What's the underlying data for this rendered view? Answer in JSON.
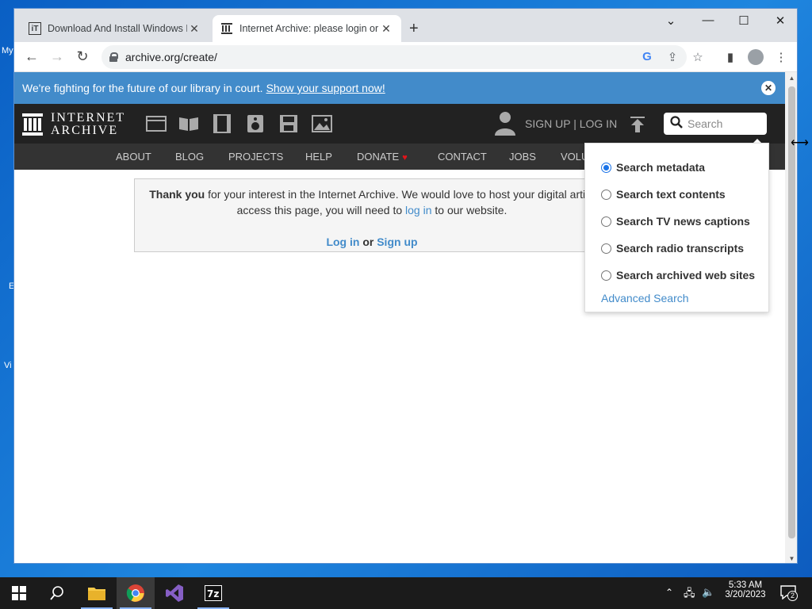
{
  "desktop": {
    "icon_labels": [
      "My",
      "E",
      "Vi"
    ]
  },
  "browser": {
    "tabs": [
      {
        "title": "Download And Install Windows M",
        "favicon": "iT",
        "close": "✕"
      },
      {
        "title": "Internet Archive: please login or j",
        "favicon": "archive-icon",
        "close": "✕"
      }
    ],
    "new_tab": "+",
    "window_controls": {
      "chevron": "⌄",
      "minimize": "—",
      "maximize": "☐",
      "close": "✕"
    },
    "url": "archive.org/create/"
  },
  "banner": {
    "text": "We're fighting for the future of our library in court.",
    "link": "Show your support now!",
    "close": "✕"
  },
  "ia_header": {
    "logo_line1": "INTERNET",
    "logo_line2": "ARCHIVE",
    "signup_login": "SIGN UP | LOG IN",
    "search_placeholder": "Search"
  },
  "nav": {
    "items": [
      "ABOUT",
      "BLOG",
      "PROJECTS",
      "HELP",
      "DONATE",
      "CONTACT",
      "JOBS",
      "VOLU"
    ]
  },
  "notice": {
    "lead": "Thank you",
    "text1": " for your interest in the Internet Archive. We would love to host your digital artifa",
    "text2": "access this page, you will need to ",
    "login_link": "log in",
    "text3": " to our website.",
    "log_in": "Log in",
    "or": " or ",
    "sign_up": "Sign up"
  },
  "search_dropdown": {
    "options": [
      {
        "label": "Search metadata",
        "checked": true
      },
      {
        "label": "Search text contents",
        "checked": false
      },
      {
        "label": "Search TV news captions",
        "checked": false
      },
      {
        "label": "Search radio transcripts",
        "checked": false
      },
      {
        "label": "Search archived web sites",
        "checked": false
      }
    ],
    "advanced": "Advanced Search"
  },
  "taskbar": {
    "time": "5:33 AM",
    "date": "3/20/2023",
    "notifications": "2"
  },
  "colors": {
    "banner": "#428bca",
    "ia_header": "#222222",
    "ia_nav": "#333333",
    "link": "#428bca"
  }
}
